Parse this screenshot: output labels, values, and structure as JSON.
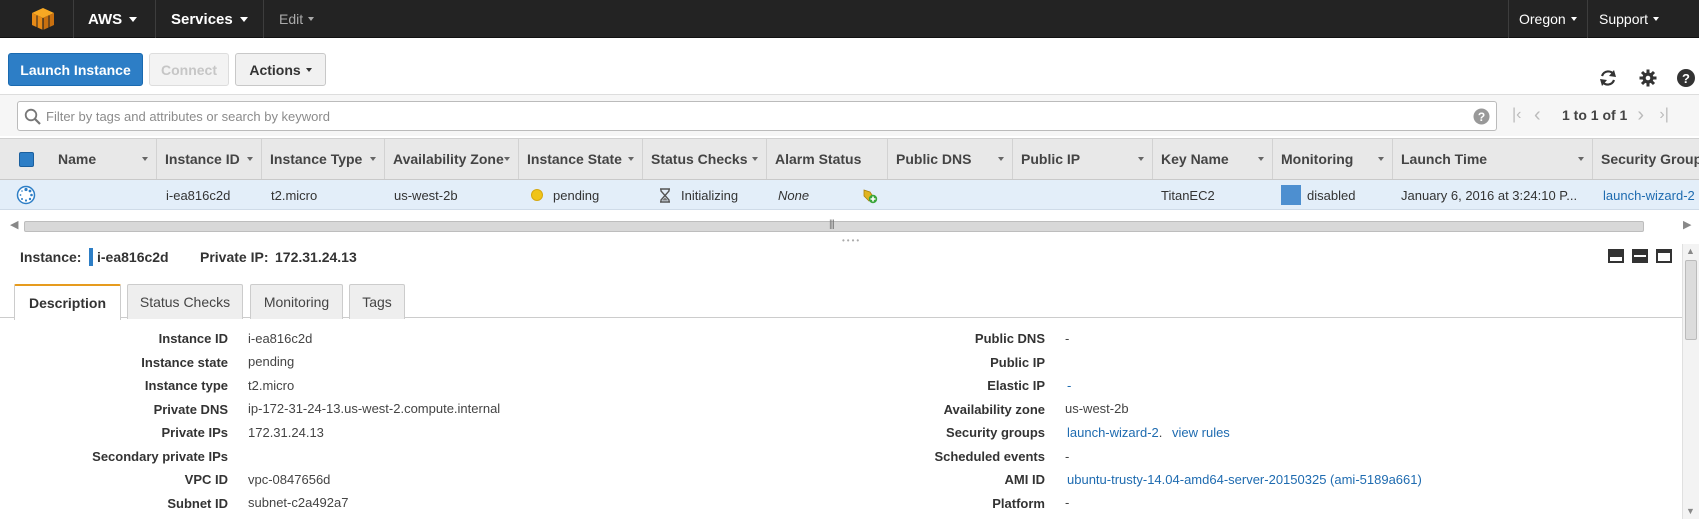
{
  "topbar": {
    "aws": "AWS",
    "services": "Services",
    "edit": "Edit",
    "region": "Oregon",
    "support": "Support"
  },
  "toolbar": {
    "launch": "Launch Instance",
    "connect": "Connect",
    "actions": "Actions"
  },
  "filter": {
    "placeholder": "Filter by tags and attributes or search by keyword",
    "pager": "1 to 1 of 1"
  },
  "columns": [
    "Name",
    "Instance ID",
    "Instance Type",
    "Availability Zone",
    "Instance State",
    "Status Checks",
    "Alarm Status",
    "Public DNS",
    "Public IP",
    "Key Name",
    "Monitoring",
    "Launch Time",
    "Security Group"
  ],
  "row": {
    "name": "",
    "instance_id": "i-ea816c2d",
    "instance_type": "t2.micro",
    "az": "us-west-2b",
    "state": "pending",
    "status_checks": "Initializing",
    "alarm": "None",
    "key_name": "TitanEC2",
    "monitoring": "disabled",
    "launch_time": "January 6, 2016 at 3:24:10 P...",
    "security_group": "launch-wizard-2"
  },
  "detail": {
    "instance_label": "Instance:",
    "instance_id": "i-ea816c2d",
    "private_ip_label": "Private IP:",
    "private_ip": "172.31.24.13",
    "tabs": [
      "Description",
      "Status Checks",
      "Monitoring",
      "Tags"
    ],
    "left": [
      {
        "label": "Instance ID",
        "value": "i-ea816c2d"
      },
      {
        "label": "Instance state",
        "value": "pending"
      },
      {
        "label": "Instance type",
        "value": "t2.micro"
      },
      {
        "label": "Private DNS",
        "value": "ip-172-31-24-13.us-west-2.compute.internal"
      },
      {
        "label": "Private IPs",
        "value": "172.31.24.13"
      },
      {
        "label": "Secondary private IPs",
        "value": ""
      },
      {
        "label": "VPC ID",
        "value": "vpc-0847656d"
      },
      {
        "label": "Subnet ID",
        "value": "subnet-c2a492a7"
      }
    ],
    "right": [
      {
        "label": "Public DNS",
        "value": "-"
      },
      {
        "label": "Public IP",
        "value": ""
      },
      {
        "label": "Elastic IP",
        "value": "-"
      },
      {
        "label": "Availability zone",
        "value": "us-west-2b"
      },
      {
        "label": "Security groups",
        "value": "launch-wizard-2",
        "extra": "view rules",
        "sep": "."
      },
      {
        "label": "Scheduled events",
        "value": "-"
      },
      {
        "label": "AMI ID",
        "value": "ubuntu-trusty-14.04-amd64-server-20150325 (ami-5189a661)"
      },
      {
        "label": "Platform",
        "value": "-"
      }
    ]
  },
  "colors": {
    "topbar": "#232323",
    "primary": "#2d7ec6",
    "selected_row": "#e3eef9",
    "link": "#1e6bb0",
    "active_tab": "#e69b1e",
    "pending_dot": "#f0c419"
  }
}
